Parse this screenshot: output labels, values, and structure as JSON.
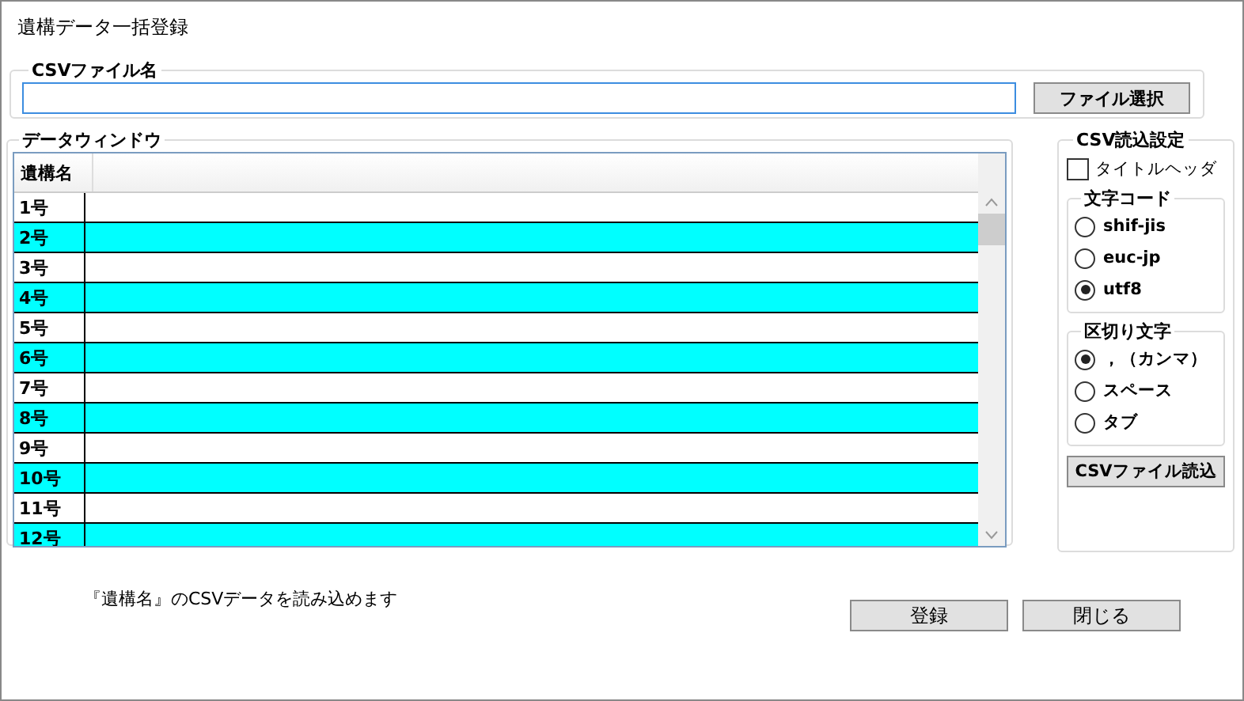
{
  "window": {
    "title": "遺構データ一括登録"
  },
  "file_group": {
    "label": "CSVファイル名",
    "button": "ファイル選択"
  },
  "data_group": {
    "label": "データウィンドウ",
    "column_header": "遺構名",
    "rows": [
      {
        "name": "1号",
        "color": "#ffffff"
      },
      {
        "name": "2号",
        "color": "#00ffff"
      },
      {
        "name": "3号",
        "color": "#ffffff"
      },
      {
        "name": "4号",
        "color": "#00ffff"
      },
      {
        "name": "5号",
        "color": "#ffffff"
      },
      {
        "name": "6号",
        "color": "#00ffff"
      },
      {
        "name": "7号",
        "color": "#ffffff"
      },
      {
        "name": "8号",
        "color": "#00ffff"
      },
      {
        "name": "9号",
        "color": "#ffffff"
      },
      {
        "name": "10号",
        "color": "#00ffff"
      },
      {
        "name": "11号",
        "color": "#ffffff"
      },
      {
        "name": "12号",
        "color": "#00ffff"
      }
    ]
  },
  "settings": {
    "label": "CSV読込設定",
    "title_header": {
      "label": "タイトルヘッダ",
      "checked": false
    },
    "encoding": {
      "label": "文字コード",
      "options": [
        {
          "label": "shif-jis",
          "selected": false
        },
        {
          "label": "euc-jp",
          "selected": false
        },
        {
          "label": "utf8",
          "selected": true
        }
      ]
    },
    "delimiter": {
      "label": "区切り文字",
      "options": [
        {
          "label": "，（カンマ）",
          "selected": true
        },
        {
          "label": "スペース",
          "selected": false
        },
        {
          "label": "タブ",
          "selected": false
        }
      ]
    },
    "button": "CSVファイル読込"
  },
  "message": "『遺構名』のCSVデータを読み込めます",
  "buttons": [
    "登録",
    "閉じる"
  ]
}
